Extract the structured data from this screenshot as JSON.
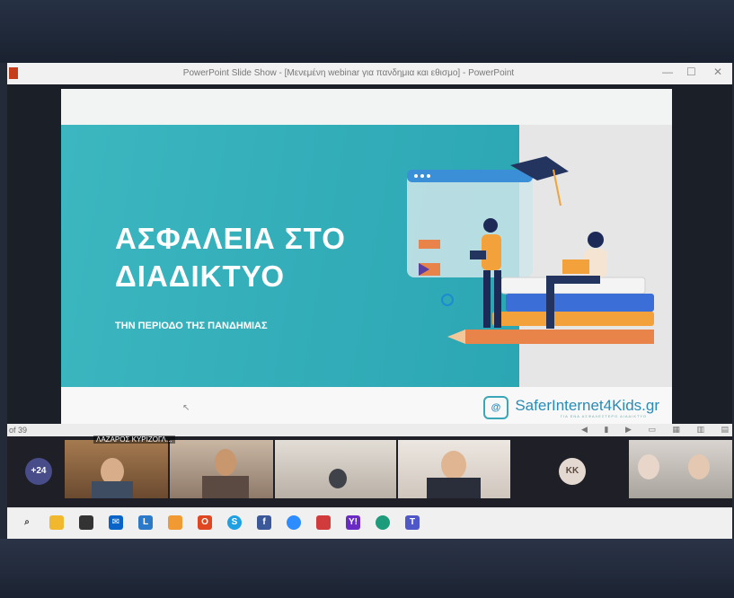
{
  "window": {
    "title": "PowerPoint Slide Show - [Μενεμένη webinar για πανδημια και εθισμο] - PowerPoint",
    "minimize": "—",
    "maximize": "☐",
    "close": "✕"
  },
  "slide": {
    "title_line1": "ΑΣΦΑΛΕΙΑ ΣΤΟ",
    "title_line2": "ΔΙΑΔΙΚΤΥΟ",
    "subtitle": "ΤΗΝ ΠΕΡΙΟΔΟ ΤΗΣ ΠΑΝΔΗΜΙΑΣ",
    "brand": "SaferInternet4Kids.gr",
    "brand_tagline": "ΓΙΑ ΕΝΑ ΑΣΦΑΛΕΣΤΕΡΟ ΔΙΑΔΙΚΤΥΟ",
    "logo_text": "@"
  },
  "statusbar": {
    "slide_counter": "of 39"
  },
  "meeting": {
    "more_participants": "+24",
    "participant_initials": "KK",
    "participant_name": "ΛΑΖΑΡΟΣ ΚΥΡΙΖΟΓΛ..."
  },
  "taskbar": {
    "icons": [
      "search-icon",
      "explorer-icon",
      "store-icon",
      "mail-icon",
      "linkedin-icon",
      "paint-icon",
      "office-icon",
      "skype-icon",
      "facebook-icon",
      "zoom-icon",
      "app-icon",
      "yahoo-icon",
      "edge-icon",
      "teams-icon"
    ],
    "letters": {
      "linkedin": "L",
      "office": "O",
      "skype": "S",
      "facebook": "f",
      "yahoo": "Y!",
      "teams": "T"
    }
  },
  "colors": {
    "slide_teal": "#2ba6b3",
    "brand_blue": "#2a8bb5",
    "badge_purple": "#484d8a"
  }
}
